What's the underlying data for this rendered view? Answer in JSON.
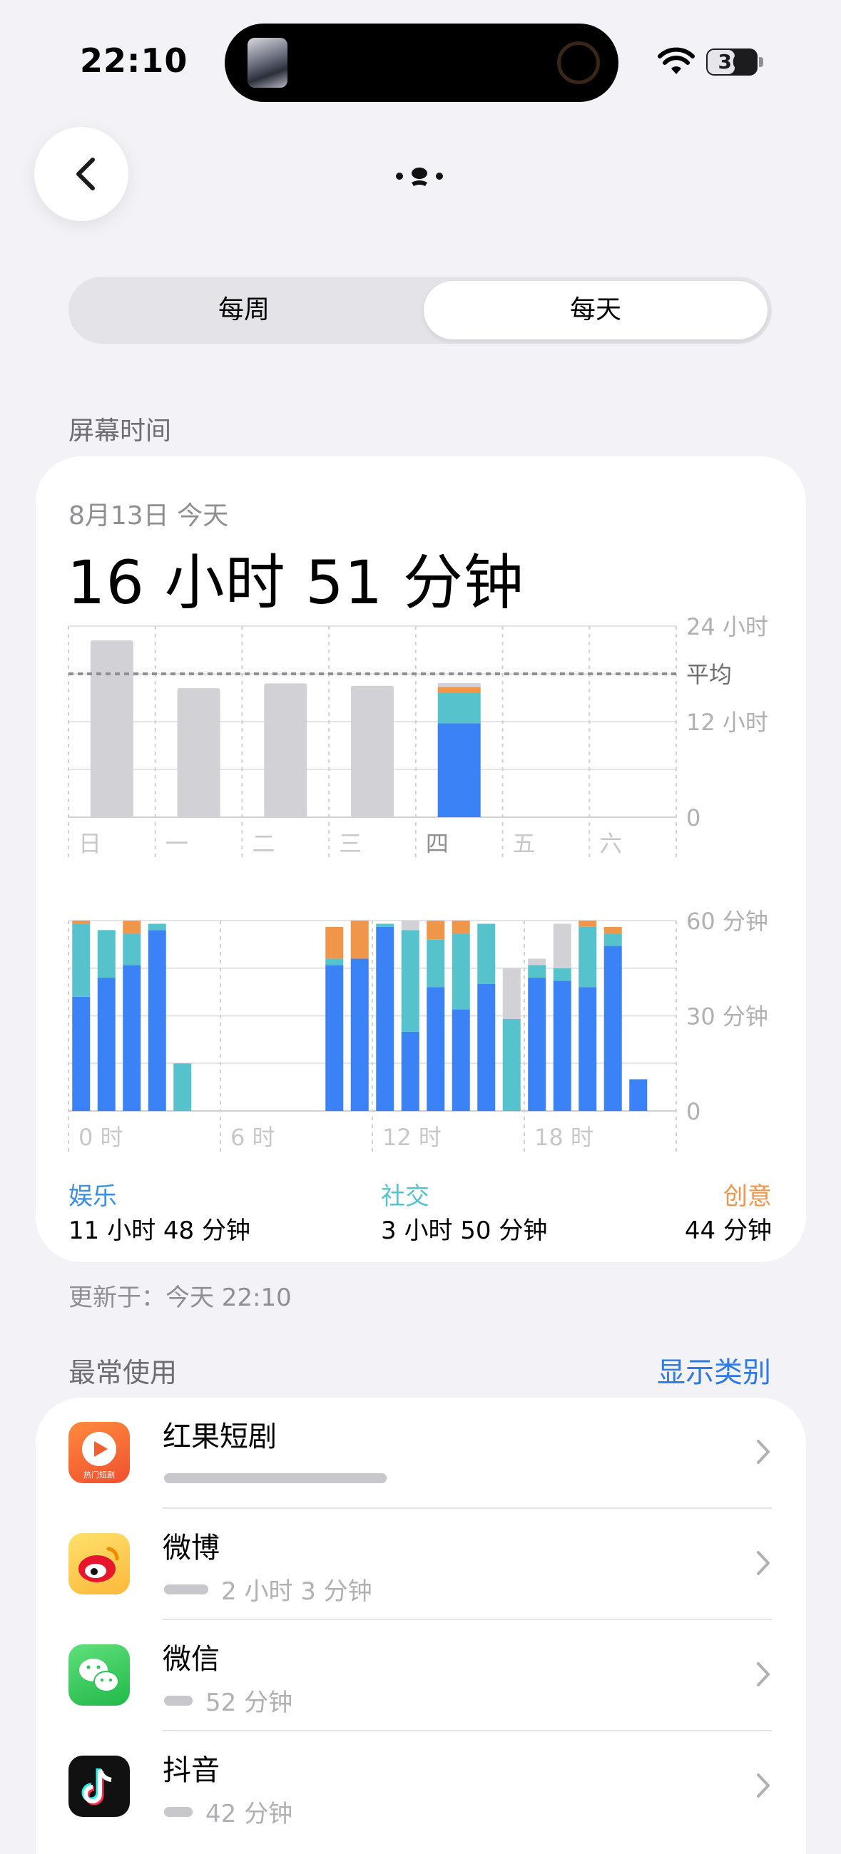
{
  "status_bar": {
    "time": "22:10",
    "battery": "36"
  },
  "segment": {
    "weekly": "每周",
    "daily": "每天",
    "selected": "daily"
  },
  "section_screen_time": "屏幕时间",
  "summary": {
    "date": "8月13日 今天",
    "total": "16 小时 51 分钟"
  },
  "colors": {
    "entertainment": "#3b82f6",
    "social": "#56c3cc",
    "creative": "#f0964a",
    "inactive": "#d1d1d6",
    "other": "#d1d1d6"
  },
  "chart_data": [
    {
      "type": "bar",
      "categories": [
        "日",
        "一",
        "二",
        "三",
        "四",
        "五",
        "六"
      ],
      "y_unit": "hours",
      "ylim": [
        0,
        24
      ],
      "ytick_labels": [
        "24 小时",
        "12 小时",
        "0"
      ],
      "average_label": "平均",
      "average": 18,
      "values": [
        22.2,
        16.2,
        16.8,
        16.5,
        16.85,
        0,
        0
      ],
      "today_index": 4,
      "today_breakdown": {
        "entertainment": 11.8,
        "social": 3.83,
        "creative": 0.73,
        "other": 0.49
      },
      "legend": "none",
      "grid": true
    },
    {
      "type": "bar",
      "stacked": true,
      "y_unit": "minutes",
      "ylim": [
        0,
        60
      ],
      "ytick_labels": [
        "60 分钟",
        "30 分钟",
        "0"
      ],
      "xtick_labels": [
        "0 时",
        "6 时",
        "12 时",
        "18 时"
      ],
      "x": [
        0,
        1,
        2,
        3,
        4,
        5,
        6,
        7,
        8,
        9,
        10,
        11,
        12,
        13,
        14,
        15,
        16,
        17,
        18,
        19,
        20,
        21,
        22,
        23
      ],
      "series": [
        {
          "key": "entertainment",
          "values": [
            36,
            42,
            46,
            57,
            0,
            0,
            0,
            0,
            0,
            0,
            46,
            48,
            58,
            25,
            39,
            32,
            40,
            0,
            42,
            41,
            39,
            52,
            10,
            0
          ]
        },
        {
          "key": "social",
          "values": [
            23,
            15,
            10,
            2,
            15,
            0,
            0,
            0,
            0,
            0,
            2,
            0,
            1,
            32,
            15,
            24,
            19,
            29,
            4,
            4,
            19,
            4,
            0,
            0
          ]
        },
        {
          "key": "creative",
          "values": [
            1,
            0,
            4,
            0,
            0,
            0,
            0,
            0,
            0,
            0,
            10,
            12,
            0,
            0,
            6,
            4,
            0,
            0,
            0,
            0,
            2,
            2,
            0,
            0
          ]
        },
        {
          "key": "other",
          "values": [
            0,
            0,
            0,
            0,
            0,
            0,
            0,
            0,
            0,
            0,
            0,
            0,
            0,
            3,
            0,
            0,
            0,
            16,
            2,
            14,
            0,
            0,
            0,
            0
          ]
        }
      ],
      "grid": true
    }
  ],
  "legend": [
    {
      "label": "娱乐",
      "value": "11 小时 48 分钟",
      "color": "#3b8ee0"
    },
    {
      "label": "社交",
      "value": "3 小时 50 分钟",
      "color": "#56c3cc"
    },
    {
      "label": "创意",
      "value": "44 分钟",
      "color": "#f0964a"
    }
  ],
  "updated": "更新于：今天 22:10",
  "most_used": {
    "title": "最常使用",
    "action": "显示类别",
    "apps": [
      {
        "name": "红果短剧",
        "duration": "",
        "bar_fraction": 0.6,
        "icon": "hongguo-icon",
        "icon_text": "热门短剧"
      },
      {
        "name": "微博",
        "duration": "2 小时 3 分钟",
        "bar_fraction": 0.12,
        "icon": "weibo-icon"
      },
      {
        "name": "微信",
        "duration": "52 分钟",
        "bar_fraction": 0.05,
        "icon": "wechat-icon"
      },
      {
        "name": "抖音",
        "duration": "42 分钟",
        "bar_fraction": 0.04,
        "icon": "douyin-icon"
      }
    ]
  }
}
